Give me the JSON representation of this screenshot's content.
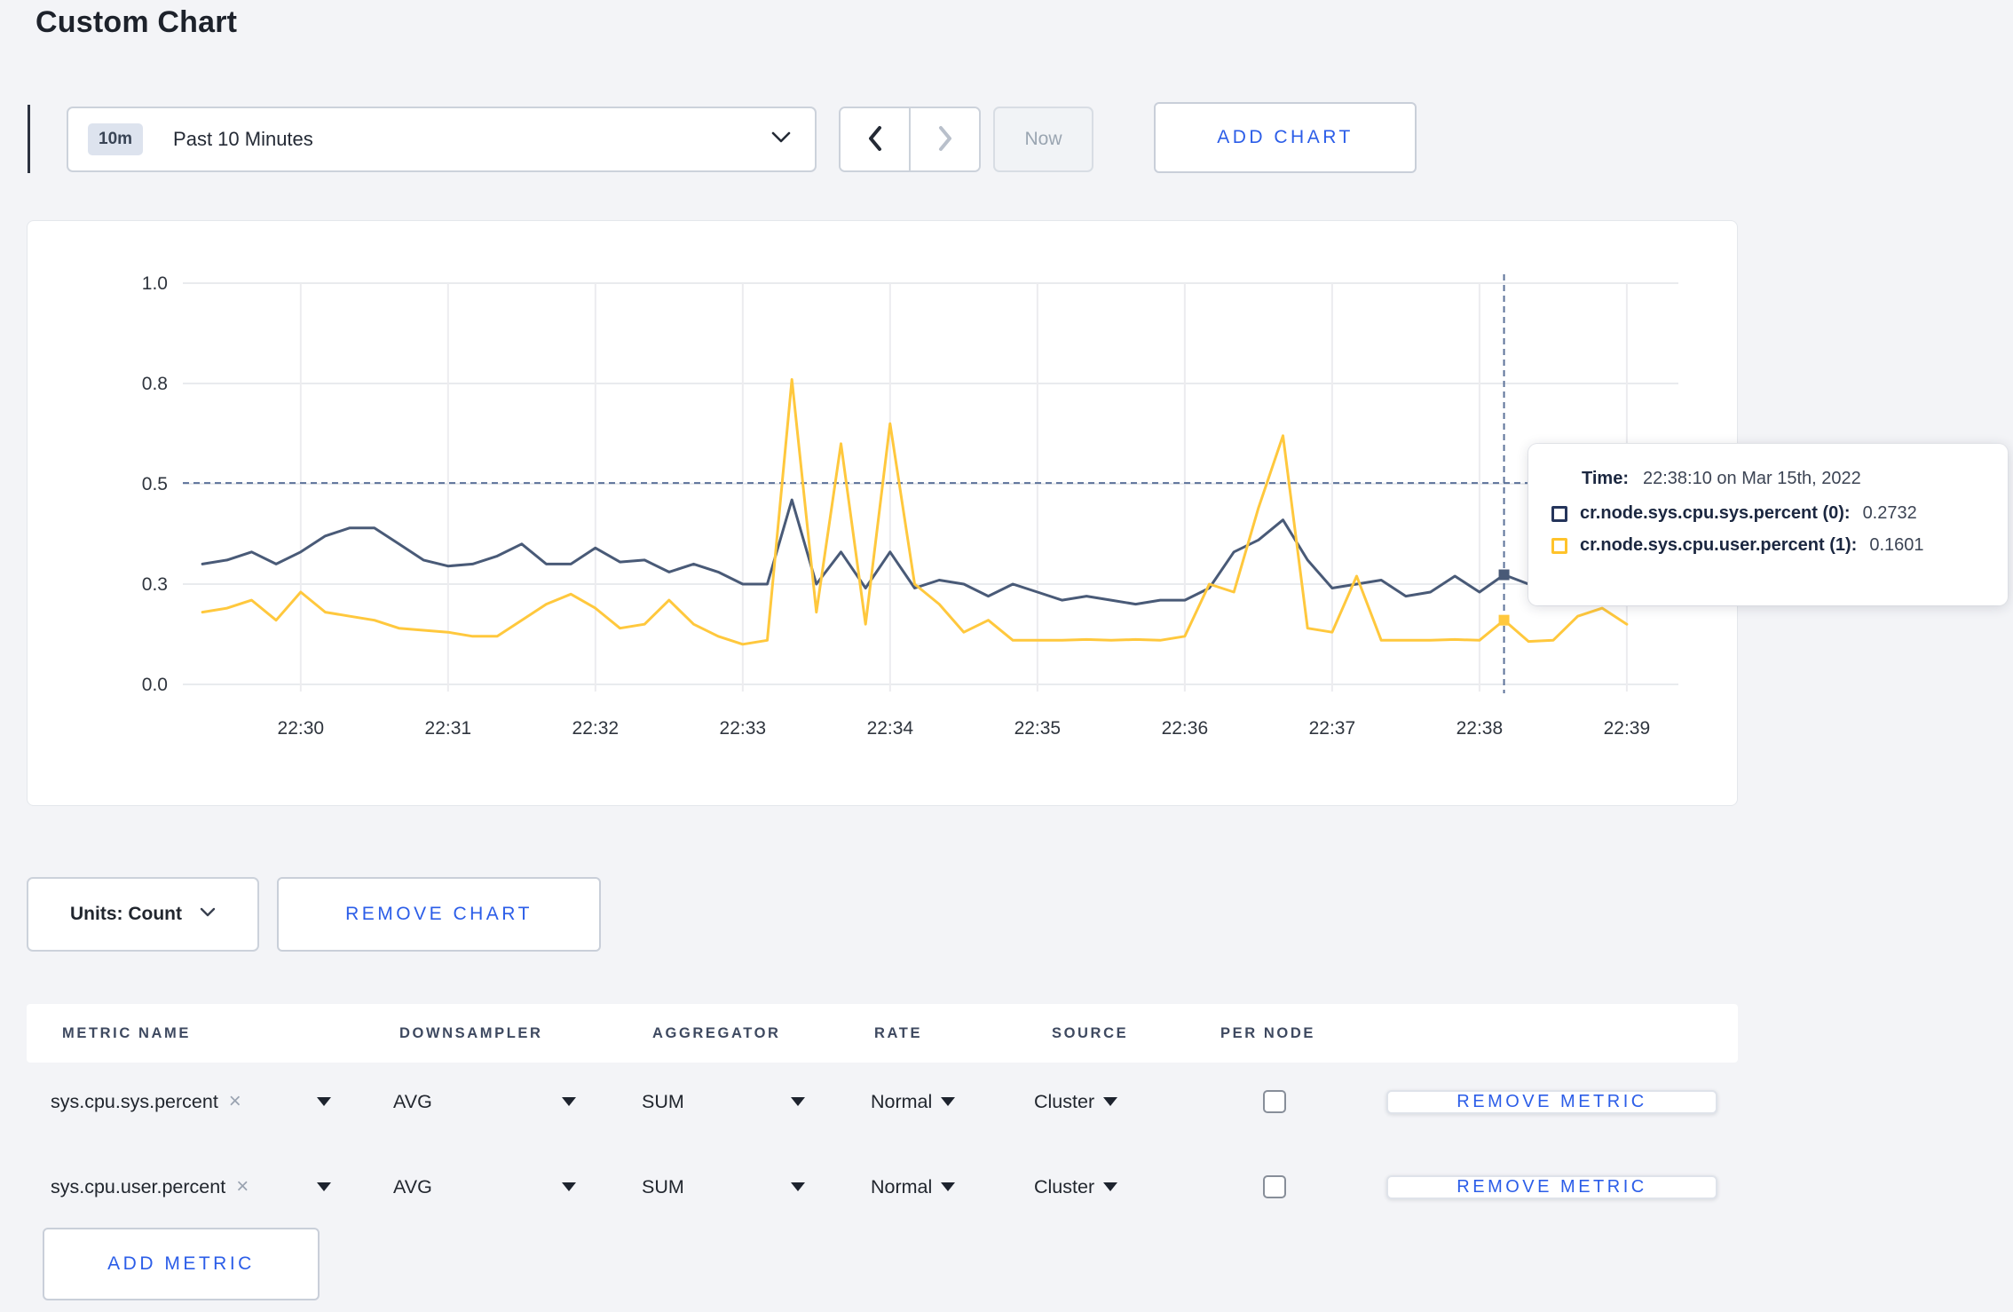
{
  "page": {
    "title": "Custom Chart",
    "background": "#f3f4f7",
    "accent_blue": "#2b5de8"
  },
  "toolbar": {
    "range_badge": "10m",
    "range_label": "Past 10 Minutes",
    "now_label": "Now",
    "add_chart_label": "ADD CHART"
  },
  "tooltip": {
    "time_label": "Time:",
    "time_value": "22:38:10 on Mar 15th, 2022",
    "rows": [
      {
        "name": "cr.node.sys.cpu.sys.percent (0):",
        "value": "0.2732",
        "square_color": "#25355b"
      },
      {
        "name": "cr.node.sys.cpu.user.percent (1):",
        "value": "0.1601",
        "square_color": "#ffc32b"
      }
    ]
  },
  "chart_data": {
    "type": "line",
    "title": "",
    "xlabel": "",
    "ylabel": "",
    "ylim": [
      0,
      1
    ],
    "grid": true,
    "x_domain": [
      "22:29:12",
      "22:39:21"
    ],
    "x_ticks": [
      "22:30",
      "22:31",
      "22:32",
      "22:33",
      "22:34",
      "22:35",
      "22:36",
      "22:37",
      "22:38",
      "22:39"
    ],
    "y_ticks": [
      {
        "value": 0,
        "label": "0.0"
      },
      {
        "value": 0.25,
        "label": "0.3"
      },
      {
        "value": 0.5,
        "label": "0.5"
      },
      {
        "value": 0.75,
        "label": "0.8"
      },
      {
        "value": 1,
        "label": "1.0"
      }
    ],
    "x_start": "22:29:20",
    "step_seconds": 10,
    "series": [
      {
        "name": "cr.node.sys.cpu.sys.percent (0)",
        "color": "#495a77",
        "values": [
          0.3,
          0.31,
          0.33,
          0.3,
          0.33,
          0.37,
          0.39,
          0.39,
          0.35,
          0.31,
          0.295,
          0.3,
          0.32,
          0.35,
          0.3,
          0.3,
          0.34,
          0.305,
          0.31,
          0.28,
          0.3,
          0.28,
          0.25,
          0.25,
          0.46,
          0.25,
          0.33,
          0.24,
          0.33,
          0.24,
          0.26,
          0.25,
          0.22,
          0.25,
          0.23,
          0.21,
          0.22,
          0.21,
          0.2,
          0.21,
          0.21,
          0.24,
          0.33,
          0.36,
          0.41,
          0.31,
          0.24,
          0.25,
          0.26,
          0.22,
          0.23,
          0.27,
          0.23,
          0.2732,
          0.25,
          0.26,
          0.27,
          0.26,
          0.27
        ]
      },
      {
        "name": "cr.node.sys.cpu.user.percent (1)",
        "color": "#ffc83d",
        "values": [
          0.18,
          0.19,
          0.21,
          0.16,
          0.23,
          0.18,
          0.17,
          0.16,
          0.14,
          0.135,
          0.13,
          0.12,
          0.12,
          0.16,
          0.2,
          0.225,
          0.19,
          0.14,
          0.15,
          0.21,
          0.15,
          0.12,
          0.1,
          0.11,
          0.76,
          0.18,
          0.6,
          0.15,
          0.65,
          0.25,
          0.2,
          0.13,
          0.16,
          0.11,
          0.11,
          0.11,
          0.112,
          0.11,
          0.112,
          0.11,
          0.12,
          0.25,
          0.23,
          0.44,
          0.62,
          0.14,
          0.13,
          0.27,
          0.11,
          0.11,
          0.11,
          0.112,
          0.11,
          0.1601,
          0.107,
          0.11,
          0.17,
          0.19,
          0.15
        ]
      }
    ],
    "crosshair": {
      "time": "22:38:10",
      "hline_value": 0.502,
      "points": [
        {
          "series": 0,
          "value": 0.2732
        },
        {
          "series": 1,
          "value": 0.1601
        }
      ]
    },
    "legend_position": "tooltip"
  },
  "units": {
    "label": "Units: Count",
    "remove_chart_label": "REMOVE CHART"
  },
  "metrics_table": {
    "headers": [
      "METRIC NAME",
      "DOWNSAMPLER",
      "AGGREGATOR",
      "RATE",
      "SOURCE",
      "PER NODE"
    ],
    "rows": [
      {
        "metric": "sys.cpu.sys.percent",
        "downsampler": "AVG",
        "aggregator": "SUM",
        "rate": "Normal",
        "source": "Cluster",
        "per_node_checked": false,
        "remove_label": "REMOVE METRIC"
      },
      {
        "metric": "sys.cpu.user.percent",
        "downsampler": "AVG",
        "aggregator": "SUM",
        "rate": "Normal",
        "source": "Cluster",
        "per_node_checked": false,
        "remove_label": "REMOVE METRIC"
      }
    ],
    "add_metric_label": "ADD METRIC"
  },
  "icons": {
    "remove_x": "×"
  }
}
